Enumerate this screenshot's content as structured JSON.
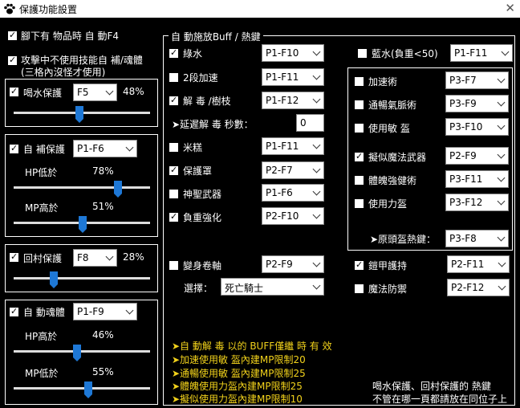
{
  "window": {
    "title": "保護功能設置",
    "close": "✕"
  },
  "left": {
    "drop_pickup": {
      "label": "腳下有 物品時 自 動F4",
      "checked": true
    },
    "no_skill_combat": {
      "label": "攻擊中不使用技能自 補/魂體",
      "sub": "(三格內沒怪才使用)",
      "checked": true
    },
    "potion": {
      "label": "喝水保護",
      "checked": true,
      "key": "F5",
      "percent": "48%",
      "value": 48
    },
    "self_heal": {
      "label": "自 補保護",
      "checked": true,
      "key": "P1-F6",
      "hp_label": "HP低於",
      "hp_percent": "78%",
      "hp_value": 78,
      "mp_label": "MP高於",
      "mp_percent": "51%",
      "mp_value": 51
    },
    "return_village": {
      "label": "回村保護",
      "checked": true,
      "key": "F8",
      "percent": "28%",
      "value": 28
    },
    "soul": {
      "label": "自 動魂體",
      "checked": true,
      "key": "P1-F9",
      "hp_label": "HP高於",
      "hp_percent": "46%",
      "hp_value": 46,
      "mp_label": "MP低於",
      "mp_percent": "55%",
      "mp_value": 55
    }
  },
  "buff": {
    "legend": "自 動施放Buff / 熱鍵",
    "items": [
      {
        "label": "綠水",
        "checked": true,
        "key": "P1-F10"
      },
      {
        "label": "2段加速",
        "checked": false,
        "key": "P1-F11"
      },
      {
        "label": "解 毒 /樹枝",
        "checked": true,
        "key": "P1-F12"
      },
      {
        "label": "米糕",
        "checked": false,
        "key": "P1-F11"
      },
      {
        "label": "保護罩",
        "checked": true,
        "key": "P2-F7"
      },
      {
        "label": "神聖武器",
        "checked": false,
        "key": "P1-F6"
      },
      {
        "label": "負重強化",
        "checked": true,
        "key": "P2-F10"
      }
    ],
    "delay_label": "➤延遲解 毒 秒數：",
    "delay_value": "0",
    "blue_water": {
      "label": "藍水(負重<50)",
      "checked": false,
      "key": "P1-F11"
    },
    "inner": [
      {
        "label": "加速術",
        "checked": false,
        "key": "P3-F7"
      },
      {
        "label": "通暢氣脈術",
        "checked": false,
        "key": "P3-F9"
      },
      {
        "label": "使用敏 盔",
        "checked": false,
        "key": "P3-F10"
      },
      {
        "label": "擬似魔法武器",
        "checked": true,
        "key": "P2-F9"
      },
      {
        "label": "體魄強健術",
        "checked": false,
        "key": "P3-F11"
      },
      {
        "label": "使用力盔",
        "checked": false,
        "key": "P3-F12"
      }
    ],
    "helmet_hotkey_label": "➤原頭盔熱鍵：",
    "helmet_hotkey": "P3-F8",
    "transform": {
      "label": "變身卷軸",
      "checked": false,
      "key": "P2-F9"
    },
    "select_label": "選擇：",
    "select_value": "死亡騎士",
    "armor": {
      "label": "鎧甲護持",
      "checked": true,
      "key": "P2-F11"
    },
    "magic_def": {
      "label": "魔法防禦",
      "checked": false,
      "key": "P2-F12"
    }
  },
  "notes": [
    "➤自 動解 毒 以的 BUFF僅繼 時 有 效",
    "➤加速使用敏 盔內建MP限制20",
    "➤通暢使用敏 盔內建MP限制25",
    "➤體魄使用力盔內建MP限制25",
    "➤擬似使用力盔內建MP限制10"
  ],
  "hint": [
    "喝水保護、回村保護的 熱鍵",
    "不管在哪一頁都請放在同位子上"
  ],
  "colors": {
    "accent": "#1e78d6",
    "note": "#f2d21b",
    "background": "#000000"
  }
}
